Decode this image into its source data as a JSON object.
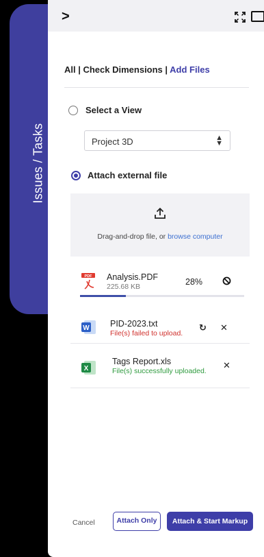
{
  "side_tab": {
    "label": "Issues / Tasks"
  },
  "topbar": {
    "back_icon": "chevron-right-icon",
    "expand_icon": "expand-icon",
    "window_icon": "window-icon"
  },
  "breadcrumb": {
    "part1": "All | Check Dimensions | ",
    "part2": "Add Files"
  },
  "options": {
    "select_view_label": "Select a View",
    "view_select_value": "Project 3D",
    "attach_label": "Attach external file",
    "selected": "attach"
  },
  "dropzone": {
    "text": "Drag-and-drop file, or ",
    "link": "browse computer",
    "icon": "upload-icon"
  },
  "files": [
    {
      "name": "Analysis.PDF",
      "sub": "225.68 KB",
      "progress_label": "28%",
      "progress": 0.28,
      "type_icon": "pdf-icon",
      "action_icon": "cancel-circle-icon"
    },
    {
      "name": "PID-2023.txt",
      "sub": "File(s) failed to upload.",
      "type_icon": "word-icon",
      "type_letter": "W",
      "retry_icon": "retry-icon",
      "remove_icon": "close-icon"
    },
    {
      "name": "Tags Report.xls",
      "sub": "File(s) successfully uploaded.",
      "type_icon": "excel-icon",
      "type_letter": "X",
      "remove_icon": "close-icon"
    }
  ],
  "footer": {
    "cancel": "Cancel",
    "attach_only": "Attach Only",
    "attach_markup": "Attach & Start Markup"
  },
  "colors": {
    "accent": "#3e3ea8",
    "error": "#d0312d",
    "success": "#2e9a3e",
    "link": "#3c6fd0"
  }
}
